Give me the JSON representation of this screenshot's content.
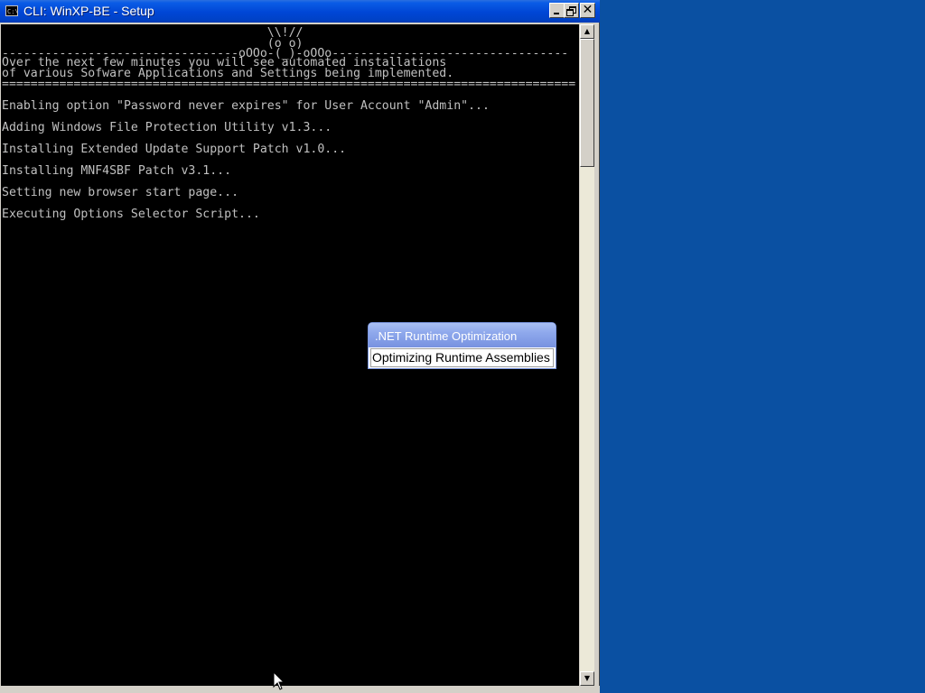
{
  "window": {
    "title": "CLI: WinXP-BE - Setup",
    "icon": "cmd-icon",
    "icon_text": "C:\\"
  },
  "console": {
    "banner": [
      "                                     \\\\!//",
      "                                     (o o)",
      "---------------------------------oOOo-(_)-oOOo---------------------------------",
      "Over the next few minutes you will see automated installations",
      "of various Sofware Applications and Settings being implemented.",
      "================================================================================"
    ],
    "lines": [
      "Enabling option \"Password never expires\" for User Account \"Admin\"...",
      "Adding Windows File Protection Utility v1.3...",
      "Installing Extended Update Support Patch v1.0...",
      "Installing MNF4SBF Patch v3.1...",
      "Setting new browser start page...",
      "Executing Options Selector Script..."
    ]
  },
  "popup": {
    "title": ".NET Runtime Optimization",
    "message": "Optimizing Runtime Assemblies"
  },
  "colors": {
    "titlebar": "#0046d5",
    "desktop": "#0a50a2",
    "console_bg": "#000000",
    "console_text": "#c0c0c0"
  }
}
